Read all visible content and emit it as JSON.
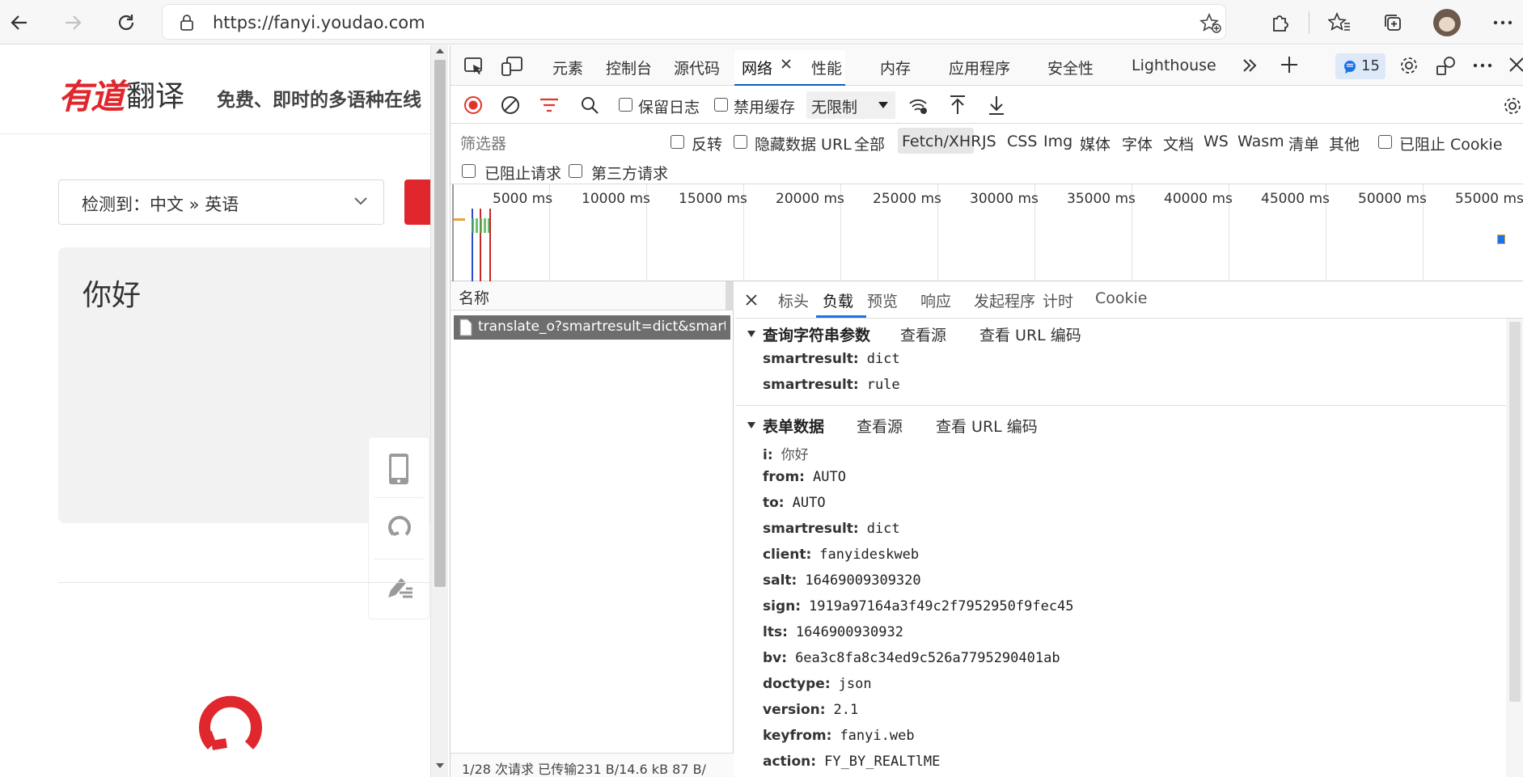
{
  "browser": {
    "url": "https://fanyi.youdao.com"
  },
  "page": {
    "logo_main": "有道",
    "logo_sub": "翻译",
    "slogan": "免费、即时的多语种在线",
    "lang_select": "检测到：中文 » 英语",
    "input_text": "你好"
  },
  "devtools": {
    "tabs": [
      "元素",
      "控制台",
      "源代码",
      "网络",
      "性能",
      "内存",
      "应用程序",
      "安全性",
      "Lighthouse"
    ],
    "active_tab": "网络",
    "issues_count": "15",
    "toolbar": {
      "preserve_log": "保留日志",
      "disable_cache": "禁用缓存",
      "throttle": "无限制"
    },
    "filter": {
      "placeholder": "筛选器",
      "invert": "反转",
      "hide_data_url": "隐藏数据 URL",
      "all": "全部",
      "types": [
        "Fetch/XHR",
        "JS",
        "CSS",
        "Img",
        "媒体",
        "字体",
        "文档",
        "WS",
        "Wasm",
        "清单",
        "其他"
      ],
      "active_type": "Fetch/XHR",
      "blocked_cookies": "已阻止 Cookie",
      "blocked_requests": "已阻止请求",
      "third_party": "第三方请求"
    },
    "timeline_ticks": [
      "5000 ms",
      "10000 ms",
      "15000 ms",
      "20000 ms",
      "25000 ms",
      "30000 ms",
      "35000 ms",
      "40000 ms",
      "45000 ms",
      "50000 ms",
      "55000 ms"
    ],
    "request_list": {
      "column": "名称",
      "request": "translate_o?smartresult=dict&smartr...",
      "status": "1/28 次请求  已传输231 B/14.6 kB  87 B/"
    },
    "detail_tabs": [
      "标头",
      "负载",
      "预览",
      "响应",
      "发起程序",
      "计时",
      "Cookie"
    ],
    "active_detail_tab": "负载",
    "query_section": {
      "title": "查询字符串参数",
      "view_source": "查看源",
      "view_url_encoded": "查看 URL 编码",
      "params": [
        {
          "k": "smartresult:",
          "v": "dict"
        },
        {
          "k": "smartresult:",
          "v": "rule"
        }
      ]
    },
    "form_section": {
      "title": "表单数据",
      "view_source": "查看源",
      "view_url_encoded": "查看 URL 编码",
      "params": [
        {
          "k": "i:",
          "v": "你好"
        },
        {
          "k": "from:",
          "v": "AUTO"
        },
        {
          "k": "to:",
          "v": "AUTO"
        },
        {
          "k": "smartresult:",
          "v": "dict"
        },
        {
          "k": "client:",
          "v": "fanyideskweb"
        },
        {
          "k": "salt:",
          "v": "16469009309320"
        },
        {
          "k": "sign:",
          "v": "1919a97164a3f49c2f7952950f9fec45"
        },
        {
          "k": "lts:",
          "v": "1646900930932"
        },
        {
          "k": "bv:",
          "v": "6ea3c8fa8c34ed9c526a7795290401ab"
        },
        {
          "k": "doctype:",
          "v": "json"
        },
        {
          "k": "version:",
          "v": "2.1"
        },
        {
          "k": "keyfrom:",
          "v": "fanyi.web"
        },
        {
          "k": "action:",
          "v": "FY_BY_REALTlME"
        }
      ]
    }
  }
}
